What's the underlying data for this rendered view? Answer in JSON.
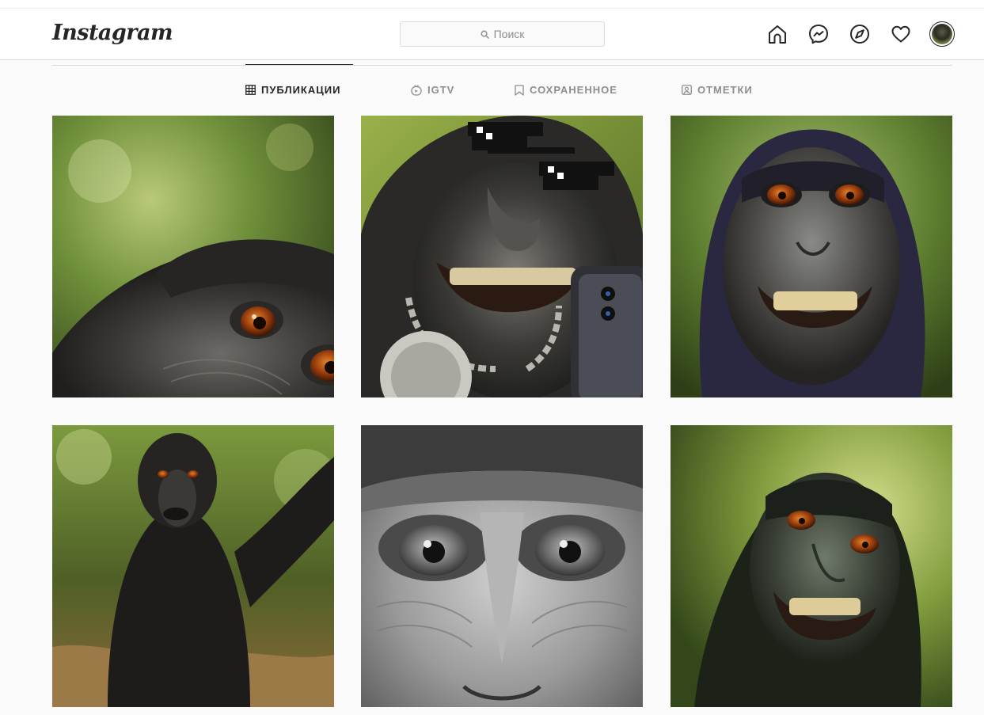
{
  "header": {
    "logo_text": "Instagram",
    "search_placeholder": "Поиск",
    "icons": [
      "home-icon",
      "messenger-icon",
      "explore-icon",
      "activity-heart-icon",
      "profile-avatar"
    ]
  },
  "tabs": [
    {
      "label": "ПУБЛИКАЦИИ",
      "icon": "grid-icon",
      "active": true
    },
    {
      "label": "IGTV",
      "icon": "igtv-icon",
      "active": false
    },
    {
      "label": "СОХРАНЕННОЕ",
      "icon": "bookmark-icon",
      "active": false
    },
    {
      "label": "ОТМЕТКИ",
      "icon": "tagged-icon",
      "active": false
    }
  ],
  "posts": [
    {
      "subject": "macaque close-up eyes, green jungle"
    },
    {
      "subject": "macaque with pixel sunglasses, chain and smartphone"
    },
    {
      "subject": "macaque grinning, jungle background"
    },
    {
      "subject": "macaque full body selfie, forest floor"
    },
    {
      "subject": "macaque eyes close-up, black and white"
    },
    {
      "subject": "macaque smiling, sunlit foliage"
    }
  ],
  "colors": {
    "background": "#fafafa",
    "text": "#262626",
    "muted": "#8e8e8e",
    "border": "#dbdbdb"
  }
}
